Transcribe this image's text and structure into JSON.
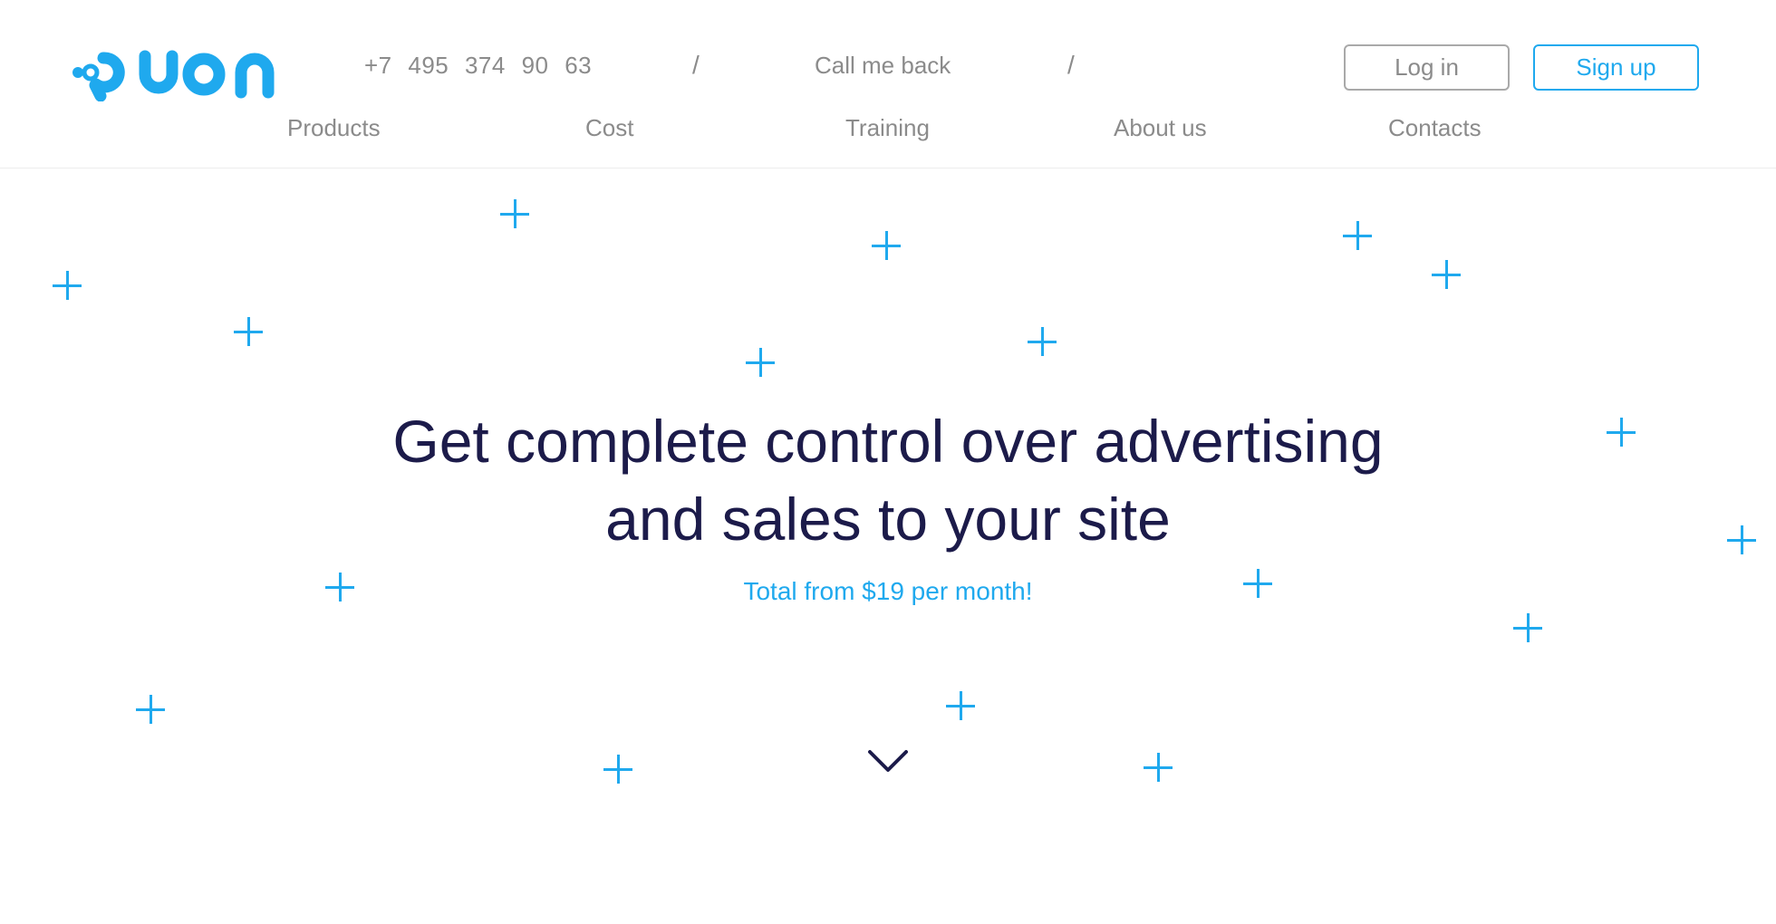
{
  "brand": {
    "name": "QUON",
    "color": "#1fa9ee"
  },
  "header": {
    "phone": "+7 495 374 90 63",
    "separator": "/",
    "callback": "Call me back",
    "login": "Log in",
    "signup": "Sign up"
  },
  "nav": {
    "products": "Products",
    "cost": "Cost",
    "training": "Training",
    "about": "About us",
    "contacts": "Contacts"
  },
  "hero": {
    "line1": "Get complete control over advertising",
    "line2": "and sales to your site",
    "subline": "Total from $19 per month!",
    "scroll_icon": "chevron-down-icon",
    "decoration_icon": "plus-icon",
    "title_color": "#1c1b4a"
  }
}
